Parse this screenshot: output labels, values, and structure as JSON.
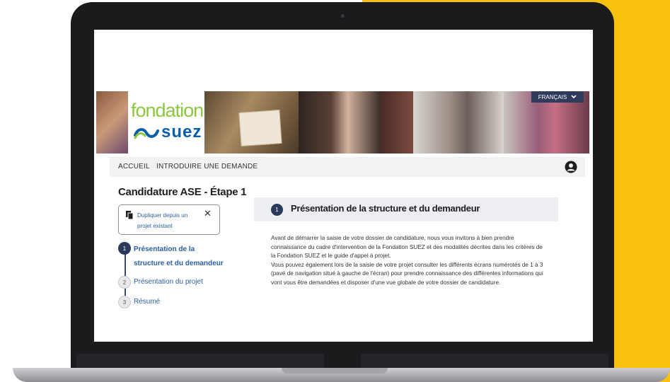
{
  "colors": {
    "accent_yellow": "#f7c10d",
    "primary_navy": "#2b3a5c",
    "link_blue": "#2b5fa5",
    "logo_green": "#8dc63f",
    "logo_blue": "#0a5fa8"
  },
  "banner": {
    "logo_word_1": "fondation",
    "logo_word_2": "suez",
    "language_button": "FRANÇAIS"
  },
  "nav": {
    "items": [
      {
        "label": "ACCUEIL"
      },
      {
        "label": "INTRODUIRE UNE DEMANDE"
      }
    ],
    "user_icon": "user-circle-icon"
  },
  "page": {
    "title": "Candidature ASE - Étape 1",
    "duplicate_box": {
      "label": "Dupliquer depuis un projet existant",
      "icon": "copy-icon",
      "close": "✕"
    },
    "steps": [
      {
        "number": "1",
        "label": "Présentation de la structure et du demandeur",
        "active": true
      },
      {
        "number": "2",
        "label": "Présentation du projet",
        "active": false
      },
      {
        "number": "3",
        "label": "Résumé",
        "active": false
      }
    ]
  },
  "section": {
    "number": "1",
    "title": "Présentation de la structure et du demandeur",
    "paragraph_1": "Avant de démarrer la saisie de votre dossier de candidature, nous vous invitons à bien prendre connaissance du cadre d'intervention de la Fondation SUEZ et des modalités décrites dans les critères de la Fondation SUEZ et le guide d'appel à projet.",
    "paragraph_2": "Vous pouvez également lors de la saisie de votre projet consulter les différents écrans numérotés de 1 à 3 (pavé de navigation situé à gauche de l'écran) pour prendre connaissance des différentes informations qui vont vous être demandées et disposer d'une vue globale de votre dossier de candidature."
  }
}
